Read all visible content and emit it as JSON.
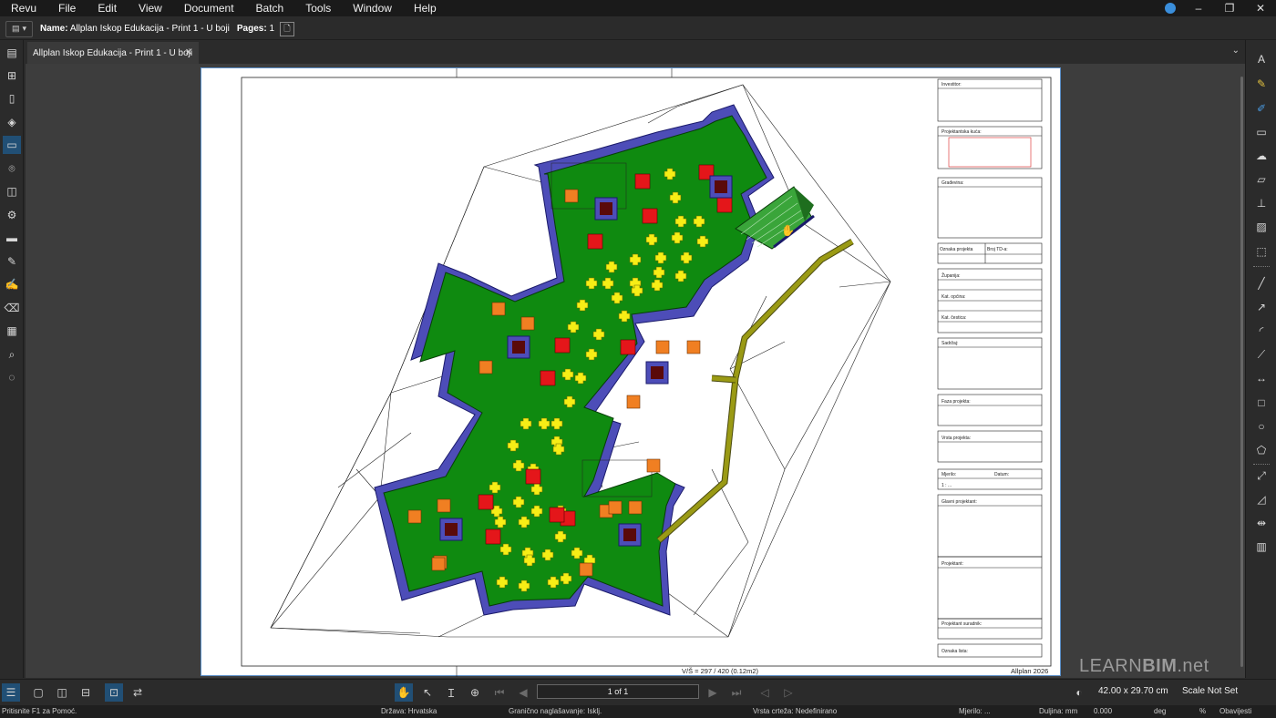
{
  "menubar": {
    "items": [
      "Revu",
      "File",
      "Edit",
      "View",
      "Document",
      "Batch",
      "Tools",
      "Window",
      "Help"
    ],
    "window_controls": [
      "–",
      "❐",
      "✕"
    ]
  },
  "docbar": {
    "name_label": "Name:",
    "name_value": "Allplan Iskop Edukacija - Print 1 - U boji",
    "pages_label": "Pages:",
    "pages_value": "1"
  },
  "tab": {
    "title": "Allplan Iskop Edukacija - Print 1 - U boji"
  },
  "left_toolbar": {
    "icons": [
      "thumbnails-icon",
      "pages-icon",
      "bookmarks-icon",
      "layers-icon",
      "toolchest-icon",
      "places-icon",
      "markups-list-icon",
      "properties-icon",
      "measurements-icon",
      "forms-icon",
      "signatures-icon",
      "erase-icon",
      "sets-icon",
      "search-icon",
      "studio-icon"
    ],
    "active": "toolchest-icon"
  },
  "right_toolbar": {
    "icons": [
      "text-icon",
      "highlighter-icon",
      "pen-icon",
      "callout-icon",
      "cloud-icon",
      "note-icon",
      "stamp-icon",
      "image-icon",
      "snapshot-icon",
      "line-icon",
      "arrow-icon",
      "arc-icon",
      "polyline-icon",
      "dimension-icon",
      "rectangle-icon",
      "ellipse-icon",
      "polygon-icon",
      "area-icon",
      "measure-icon",
      "count-icon",
      "hatch-icon"
    ]
  },
  "drawing": {
    "scale_note": "V/Š = 297 / 420 (0.12m2)",
    "software_label": "Allplan 2026",
    "title_block": [
      "Investitor:",
      "Projektantska kuća:",
      "Građevina:",
      "Oznaka projekta",
      "Broj TD-a:",
      "Županija:",
      "Kat. općina:",
      "Kat. čestica:",
      "Sadržaj:",
      "Faza projekta:",
      "Vrsta projekta:",
      "Mjerilo:",
      "Datum:",
      "1 : ...",
      "Glavni projektant:",
      "Projektant:",
      "Projektant suradnik:",
      "Oznaka lista:"
    ]
  },
  "watermark": {
    "part1": "LEARN",
    "part2": "BIM",
    "part3": ".net"
  },
  "navbar": {
    "page_indicator": "1 of 1",
    "page_size": "42.00 x 29.70 cm",
    "scale": "Scale Not Set"
  },
  "statusbar": {
    "items": [
      "Pritisnite F1 za Pomoć.",
      "Država: Hrvatska",
      "Granično naglašavanje: Isklj.",
      "Vrsta crteža: Nedefinirano",
      "Mjerilo: ...",
      "Duljina: mm",
      "0.000",
      "deg",
      "%",
      "Obavijesti"
    ]
  },
  "colors": {
    "menubar_bg": "#1a1a1a",
    "panel_bg": "#2b2b2b",
    "doc_bg": "#3d3d3d",
    "active_blue": "#214f75",
    "terrain_green": "#0f8a10",
    "wall_blue": "#4d4db8",
    "path_olive": "#9a9a14",
    "plant_yellow": "#f6ee16",
    "plant_orange": "#f07f22",
    "plant_red": "#e4161a"
  }
}
